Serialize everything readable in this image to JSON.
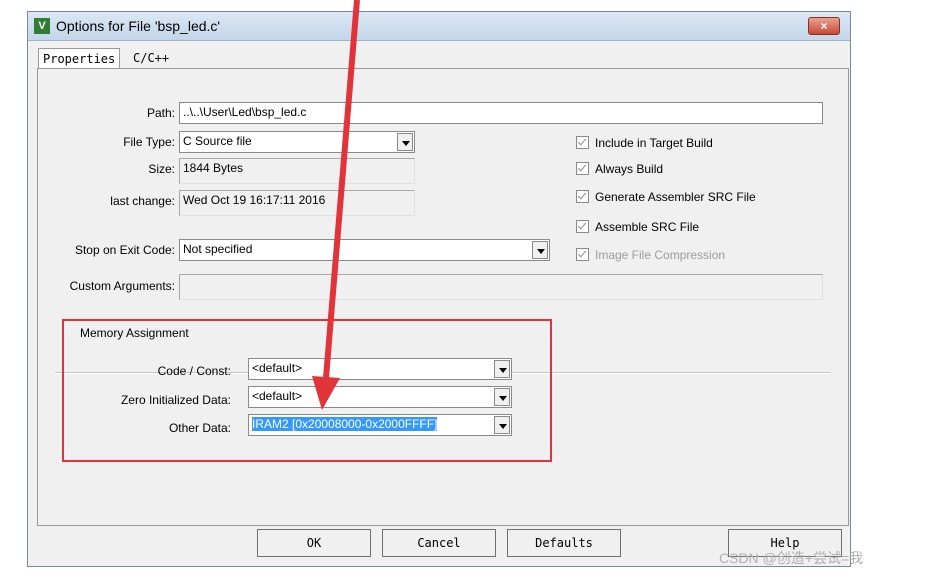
{
  "window": {
    "title": "Options for File 'bsp_led.c'",
    "close_label": "×",
    "icon_letter": "V"
  },
  "tabs": [
    {
      "label": "Properties"
    },
    {
      "label": "C/C++"
    }
  ],
  "form": {
    "path_label": "Path:",
    "path_value": "..\\..\\User\\Led\\bsp_led.c",
    "filetype_label": "File Type:",
    "filetype_value": "C Source file",
    "size_label": "Size:",
    "size_value": "1844 Bytes",
    "lastchange_label": "last change:",
    "lastchange_value": "Wed Oct 19 16:17:11 2016",
    "stop_label": "Stop on Exit Code:",
    "stop_value": "Not specified",
    "custom_label": "Custom Arguments:",
    "custom_value": ""
  },
  "options": [
    {
      "label": "Include in Target Build",
      "checked": true,
      "enabled": true
    },
    {
      "label": "Always Build",
      "checked": true,
      "enabled": true
    },
    {
      "label": "Generate Assembler SRC File",
      "checked": true,
      "enabled": true
    },
    {
      "label": "Assemble SRC File",
      "checked": true,
      "enabled": true
    },
    {
      "label": "Image File Compression",
      "checked": true,
      "enabled": false
    }
  ],
  "memory": {
    "group_title": "Memory Assignment",
    "code_label": "Code / Const:",
    "code_value": "<default>",
    "zero_label": "Zero Initialized Data:",
    "zero_value": "<default>",
    "other_label": "Other Data:",
    "other_value": "IRAM2 [0x20008000-0x2000FFFF]"
  },
  "buttons": {
    "ok": "OK",
    "cancel": "Cancel",
    "defaults": "Defaults",
    "help": "Help"
  },
  "watermark": "CSDN @创造+尝试=我",
  "colors": {
    "annotation": "#e0343a",
    "selection": "#3399ff"
  }
}
